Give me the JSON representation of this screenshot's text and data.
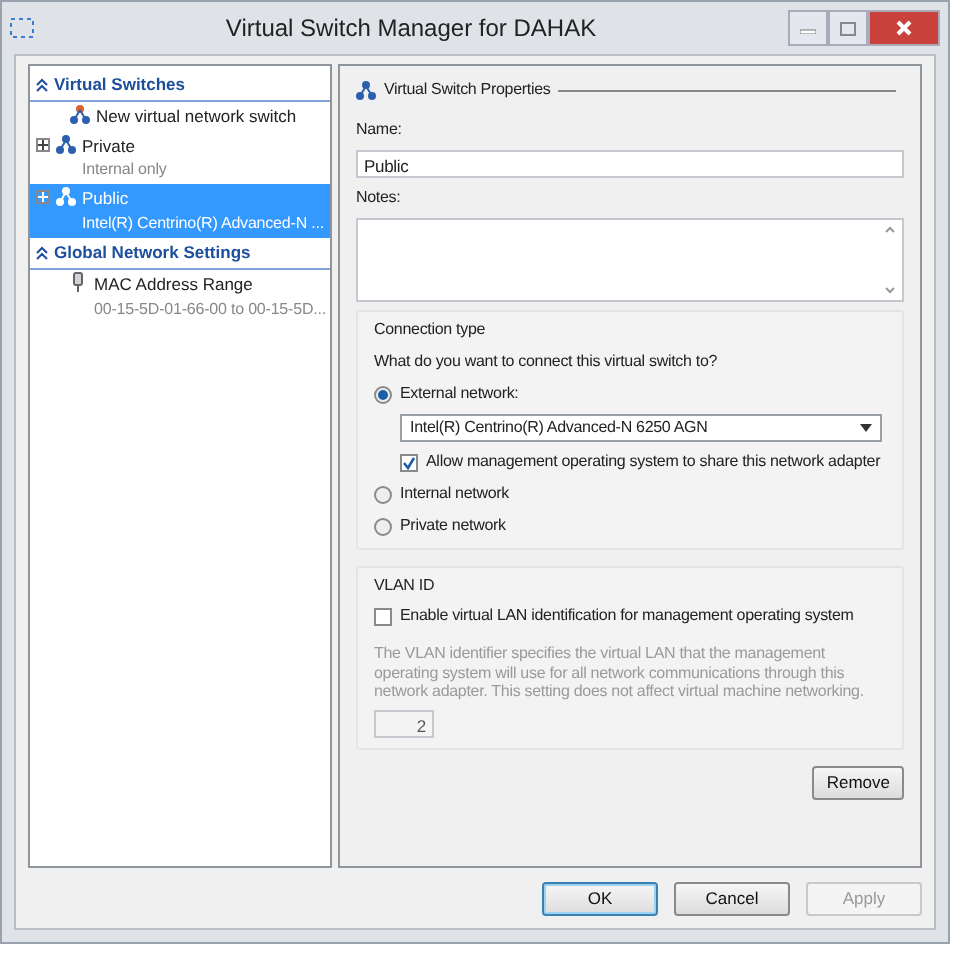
{
  "window": {
    "title": "Virtual Switch Manager for DAHAK"
  },
  "sidebar": {
    "sections": [
      {
        "title": "Virtual Switches",
        "expanded": true,
        "items": [
          {
            "kind": "new",
            "label": "New virtual network switch",
            "selected": false
          },
          {
            "kind": "switch",
            "label": "Private",
            "sublabel": "Internal only",
            "selected": false
          },
          {
            "kind": "switch",
            "label": "Public",
            "sublabel": "Intel(R) Centrino(R) Advanced-N ...",
            "selected": true
          }
        ]
      },
      {
        "title": "Global Network Settings",
        "expanded": true,
        "items": [
          {
            "kind": "mac",
            "label": "MAC Address Range",
            "sublabel": "00-15-5D-01-66-00 to 00-15-5D...",
            "selected": false
          }
        ]
      }
    ]
  },
  "properties": {
    "title": "Virtual Switch Properties",
    "name_label": "Name:",
    "name_value": "Public",
    "notes_label": "Notes:",
    "connection": {
      "title": "Connection type",
      "question": "What do you want to connect this virtual switch to?",
      "options": [
        {
          "label": "External network:",
          "selected": true
        },
        {
          "label": "Internal network",
          "selected": false
        },
        {
          "label": "Private network",
          "selected": false
        }
      ],
      "adapter": "Intel(R) Centrino(R) Advanced-N 6250 AGN",
      "share": {
        "label": "Allow management operating system to share this network adapter",
        "checked": true
      }
    },
    "vlan": {
      "title": "VLAN ID",
      "enable": {
        "label": "Enable virtual LAN identification for management operating system",
        "checked": false
      },
      "description": "The VLAN identifier specifies the virtual LAN that the management operating system will use for all network communications through this network adapter. This setting does not affect virtual machine networking.",
      "value": "2"
    },
    "remove_button": "Remove"
  },
  "buttons": [
    {
      "label": "OK",
      "disabled": false,
      "default": true
    },
    {
      "label": "Cancel",
      "disabled": false,
      "default": false
    },
    {
      "label": "Apply",
      "disabled": true,
      "default": false
    }
  ]
}
